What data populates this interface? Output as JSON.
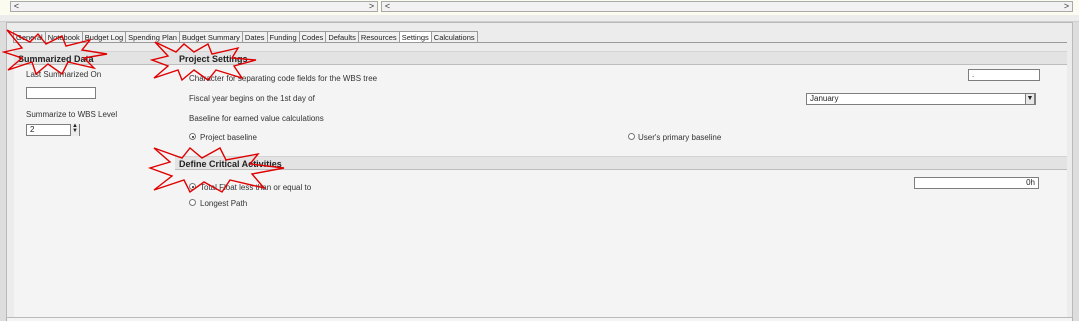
{
  "top": {
    "left_arrow": "<",
    "right_arrow_1": ">",
    "left_arrow_2": "<",
    "right_arrow_2": ">"
  },
  "tabs": [
    "General",
    "Notebook",
    "Budget Log",
    "Spending Plan",
    "Budget Summary",
    "Dates",
    "Funding",
    "Codes",
    "Defaults",
    "Resources",
    "Settings",
    "Calculations"
  ],
  "active_tab": "Settings",
  "summarized": {
    "header": "Summarized Data",
    "last_label": "Last Summarized On",
    "last_value": "",
    "wbs_label": "Summarize to WBS Level",
    "wbs_value": "2"
  },
  "project_settings": {
    "header": "Project Settings",
    "separator_label": "Character for separating code fields for the WBS tree",
    "separator_value": ".",
    "fiscal_label": "Fiscal year begins on the 1st day of",
    "fiscal_value": "January",
    "baseline_label": "Baseline for earned value calculations",
    "baseline_project": "Project baseline",
    "baseline_user": "User's primary baseline"
  },
  "critical": {
    "header": "Define Critical Activities",
    "total_float_label": "Total Float less than or equal to",
    "total_float_value": "0h",
    "longest_path_label": "Longest Path"
  }
}
